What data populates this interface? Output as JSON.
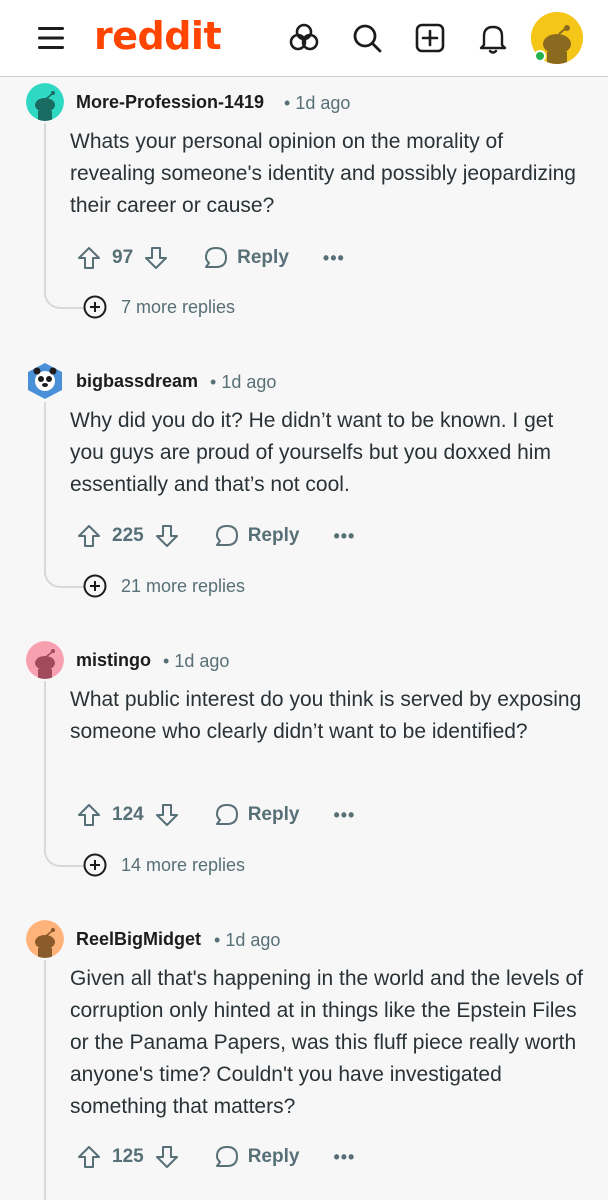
{
  "app": {
    "logo_text": "reddit",
    "brand_color": "#ff4500"
  },
  "header": {
    "icons": [
      "menu-icon",
      "explore-icon",
      "search-icon",
      "create-post-icon",
      "notifications-icon",
      "user-avatar"
    ]
  },
  "comments": [
    {
      "author": "More-Profession-1419",
      "time": "1d ago",
      "body": "Whats your personal opinion on the morality of revealing someone's identity and possibly jeopardizing their career or cause?",
      "votes": "97",
      "reply_label": "Reply",
      "more_label": "•••",
      "more_replies": "7 more replies",
      "avatar_color": "#2ed8c3"
    },
    {
      "author": "bigbassdream",
      "time": "1d ago",
      "body": "Why did you do it? He didn’t want to be known. I get you guys are proud of yourselfs but you doxxed him essentially and that’s not cool.",
      "votes": "225",
      "reply_label": "Reply",
      "more_label": "•••",
      "more_replies": "21 more replies",
      "avatar_color": "#6cb3e8"
    },
    {
      "author": "mistingo",
      "time": "1d ago",
      "body": "What public interest do you think is served by exposing someone who clearly didn’t want to be identified?",
      "votes": "124",
      "reply_label": "Reply",
      "more_label": "•••",
      "more_replies": "14 more replies",
      "avatar_color": "#f7a0b0"
    },
    {
      "author": "ReelBigMidget",
      "time": "1d ago",
      "body": "Given all that's happening in the world and the levels of corruption only hinted at in things like the Epstein Files or the Panama Papers, was this fluff piece really worth anyone's time? Couldn't you have investigated something that matters?",
      "votes": "125",
      "reply_label": "Reply",
      "more_label": "•••",
      "avatar_color": "#ffb27a"
    }
  ]
}
